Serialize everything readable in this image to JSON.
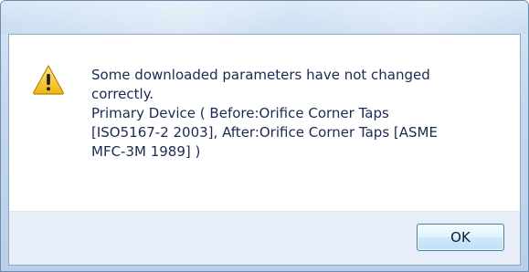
{
  "dialog": {
    "message": "Some downloaded parameters have not changed\ncorrectly.\nPrimary Device ( Before:Orifice Corner Taps\n[ISO5167-2 2003], After:Orifice Corner Taps [ASME\nMFC-3M 1989] )",
    "icon": "warning-icon",
    "ok_label": "OK"
  },
  "colors": {
    "text": "#1a2a52",
    "warning_fill": "#f5c518",
    "button_border": "#3c7fb1"
  }
}
